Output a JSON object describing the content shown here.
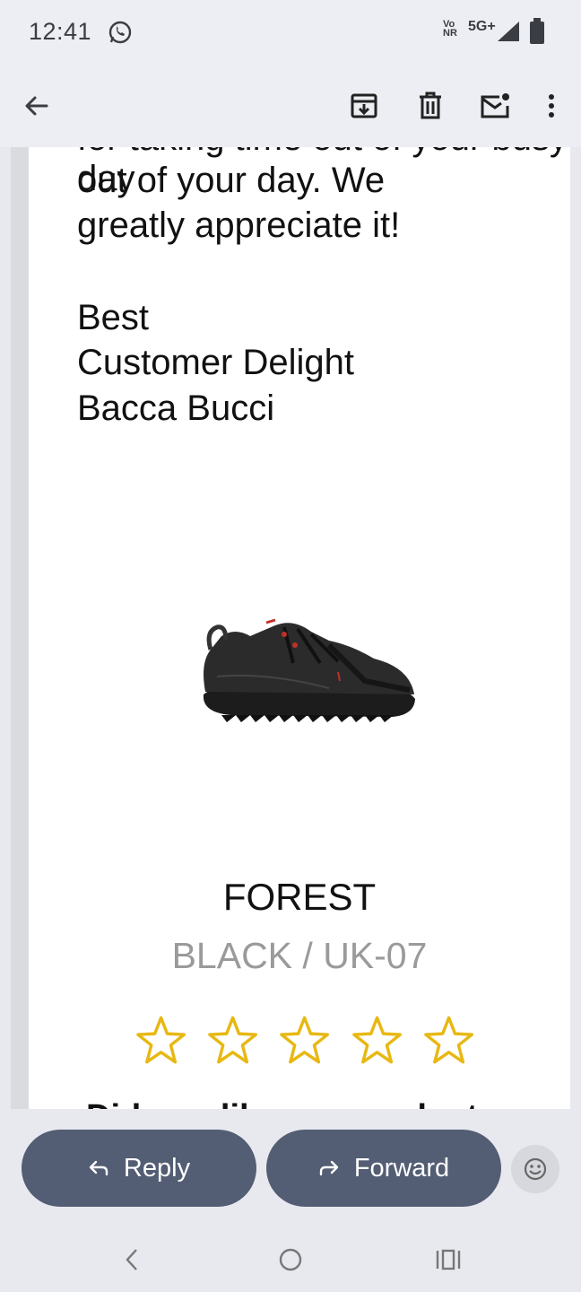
{
  "status_bar": {
    "time": "12:41",
    "network_top": "Vo",
    "network_bottom": "NR",
    "network_type": "5G+"
  },
  "toolbar": {
    "icons": [
      "back-arrow-icon",
      "archive-icon",
      "delete-icon",
      "mark-unread-icon",
      "more-options-icon"
    ]
  },
  "email": {
    "cut_top_line": "for taking time out of your busy day",
    "lines": [
      "out of your day. We",
      "greatly appreciate it!"
    ],
    "signoff": [
      "Best",
      "Customer Delight",
      "Bacca Bucci"
    ],
    "product": {
      "name": "FOREST",
      "variant": "BLACK / UK-07",
      "rating_stars_total": 5,
      "rating_stars_filled": 0
    },
    "cut_bottom_line": "Did you like our product"
  },
  "actions": {
    "reply_label": "Reply",
    "forward_label": "Forward"
  },
  "colors": {
    "action_button": "#535d73",
    "star_outline": "#e8b812",
    "variant_text": "#9a9a9a"
  }
}
